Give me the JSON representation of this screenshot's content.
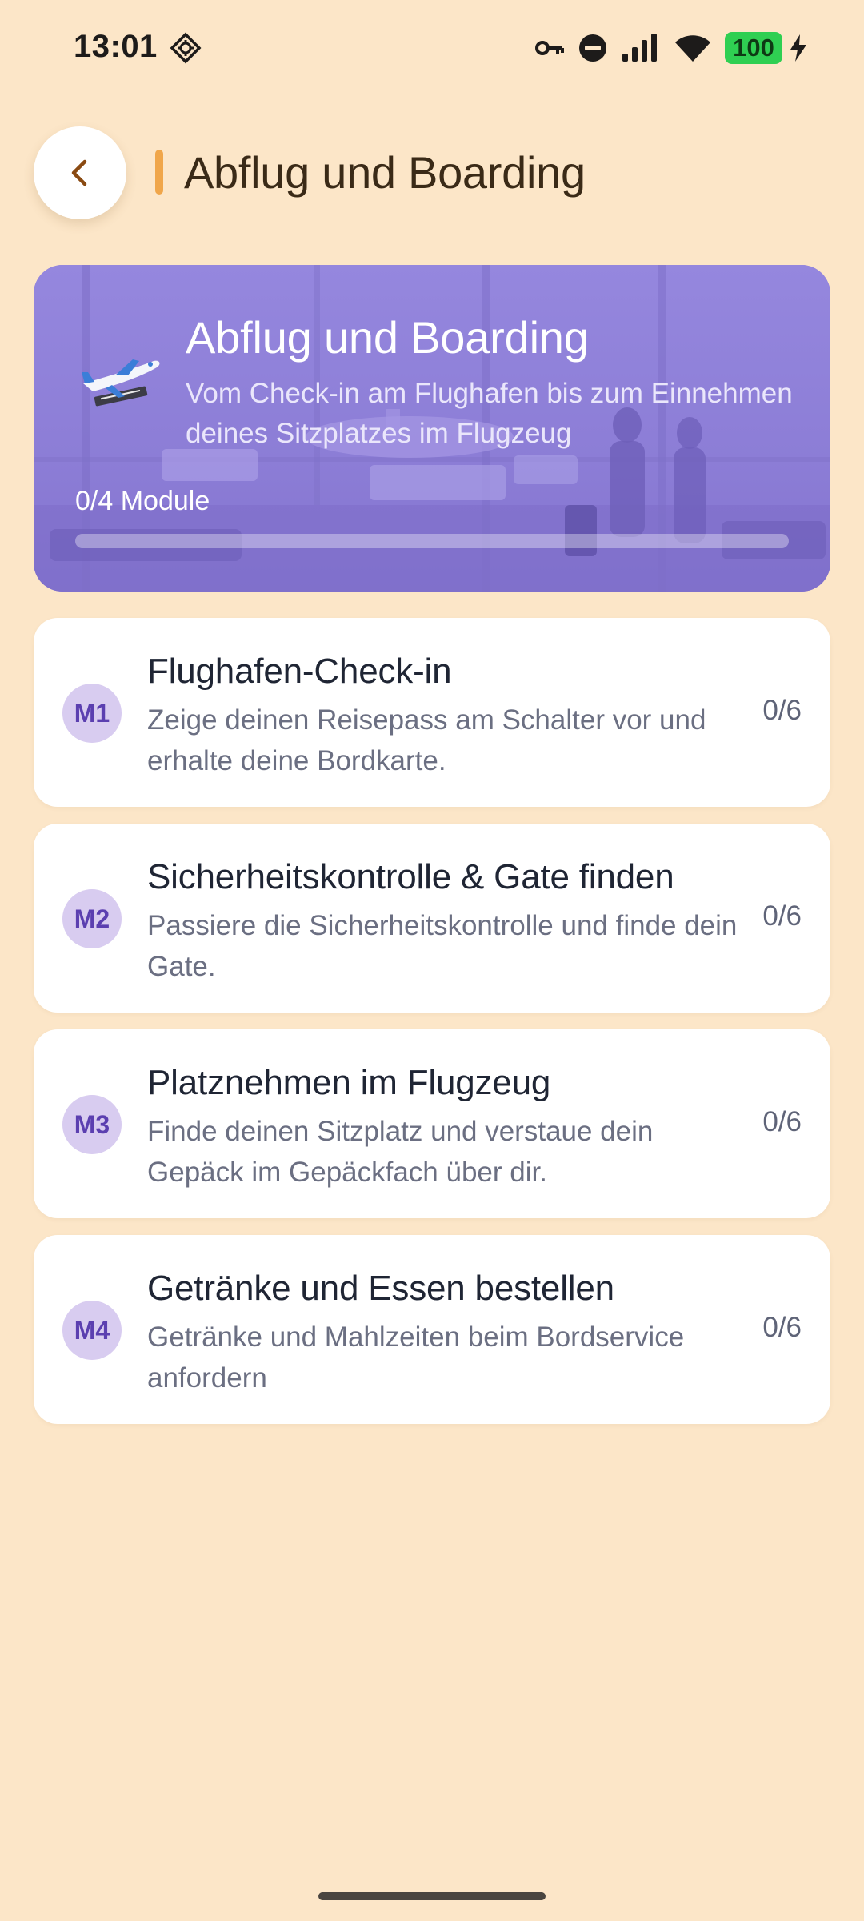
{
  "status_bar": {
    "time": "13:01",
    "battery": "100",
    "icons": [
      "vpn-key-icon",
      "do-not-disturb-icon",
      "signal-icon",
      "wifi-icon",
      "battery-icon",
      "charging-bolt-icon"
    ]
  },
  "header": {
    "title": "Abflug und Boarding",
    "back_icon": "chevron-left-icon",
    "accent_color": "#f0a64a"
  },
  "hero": {
    "title": "Abflug und Boarding",
    "subtitle": "Vom Check-in am Flughafen bis zum Einnehmen deines Sitzplatzes im Flugzeug",
    "progress_label": "0/4 Module",
    "progress_fraction": 0,
    "icon": "airplane-departure-icon",
    "color": "#8d7ed6"
  },
  "modules": [
    {
      "badge": "M1",
      "title": "Flughafen-Check-in",
      "description": "Zeige deinen Reisepass am Schalter vor und erhalte deine Bordkarte.",
      "progress": "0/6"
    },
    {
      "badge": "M2",
      "title": "Sicherheitskontrolle & Gate finden",
      "description": "Passiere die Sicherheitskontrolle und finde dein Gate.",
      "progress": "0/6"
    },
    {
      "badge": "M3",
      "title": "Platznehmen im Flugzeug",
      "description": "Finde deinen Sitzplatz und verstaue dein Gepäck im Gepäckfach über dir.",
      "progress": "0/6"
    },
    {
      "badge": "M4",
      "title": "Getränke und Essen bestellen",
      "description": "Getränke und Mahlzeiten beim Bordservice anfordern",
      "progress": "0/6"
    }
  ]
}
